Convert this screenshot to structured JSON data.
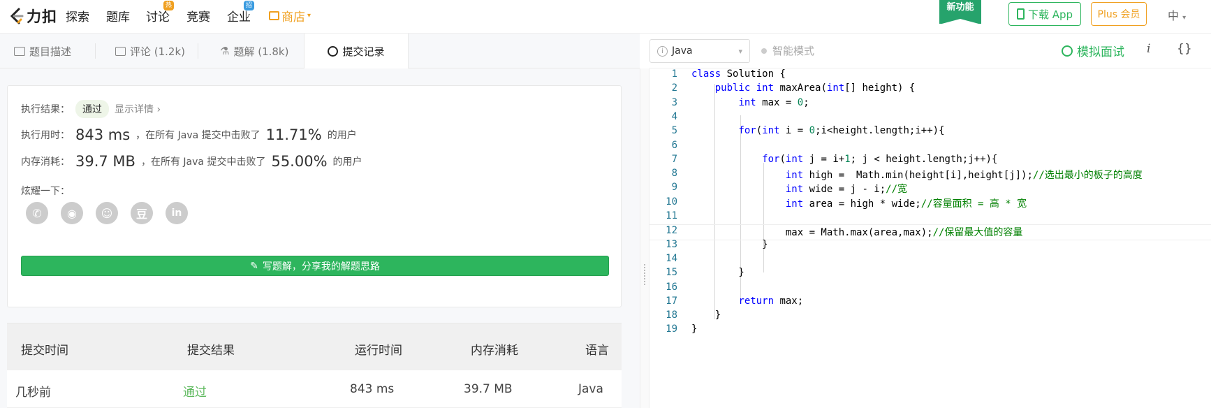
{
  "topnav": {
    "brand": "力扣",
    "items": [
      {
        "label": "探索"
      },
      {
        "label": "题库"
      },
      {
        "label": "讨论",
        "badge": "热门"
      },
      {
        "label": "竞赛"
      },
      {
        "label": "企业",
        "badge": "招聘"
      },
      {
        "label": "商店"
      }
    ],
    "new_feature": "新功能",
    "download_app": "下载 App",
    "plus": "Plus 会员",
    "lang": "中"
  },
  "tabs": [
    {
      "label": "题目描述",
      "icon": "document-icon"
    },
    {
      "label": "评论 (1.2k)",
      "icon": "comment-icon"
    },
    {
      "label": "题解 (1.8k)",
      "icon": "flask-icon"
    },
    {
      "label": "提交记录",
      "icon": "clock-icon",
      "active": true
    }
  ],
  "result": {
    "exec_result_label": "执行结果：",
    "status": "通过",
    "show_details": "显示详情",
    "time_label": "执行用时：",
    "time_value": "843 ms",
    "time_mid": "，在所有 Java 提交中击败了",
    "time_pct": "11.71%",
    "time_tail": "的用户",
    "mem_label": "内存消耗：",
    "mem_value": "39.7 MB",
    "mem_mid": "，在所有 Java 提交中击败了",
    "mem_pct": "55.00%",
    "mem_tail": "的用户",
    "share_label": "炫耀一下：",
    "share_icons": [
      "wechat-icon",
      "weibo-icon",
      "qq-icon",
      "douban-icon",
      "linkedin-icon"
    ],
    "write_solution": "写题解，分享我的解题思路"
  },
  "submissions": {
    "headers": [
      "提交时间",
      "提交结果",
      "运行时间",
      "内存消耗",
      "语言"
    ],
    "rows": [
      {
        "time": "几秒前",
        "result": "通过",
        "runtime": "843 ms",
        "memory": "39.7 MB",
        "language": "Java"
      }
    ]
  },
  "editor_bar": {
    "language": "Java",
    "smart_mode": "智能模式",
    "mock_interview": "模拟面试",
    "info": "i",
    "braces": "{}"
  },
  "code": {
    "lines": [
      "class Solution {",
      "    public int maxArea(int[] height) {",
      "        int max = 0;",
      "",
      "        for(int i = 0;i<height.length;i++){",
      "",
      "            for(int j = i+1; j < height.length;j++){",
      "                int high =  Math.min(height[i],height[j]);//选出最小的板子的高度",
      "                int wide = j - i;//宽",
      "                int area = high * wide;//容量面积 = 高 * 宽",
      "",
      "                max = Math.max(area,max);//保留最大值的容量",
      "            }",
      "",
      "        }",
      "",
      "        return max;",
      "    }",
      "}"
    ],
    "current_line": 12
  },
  "colors": {
    "accent": "#2db55d",
    "shop": "#f0a020"
  }
}
